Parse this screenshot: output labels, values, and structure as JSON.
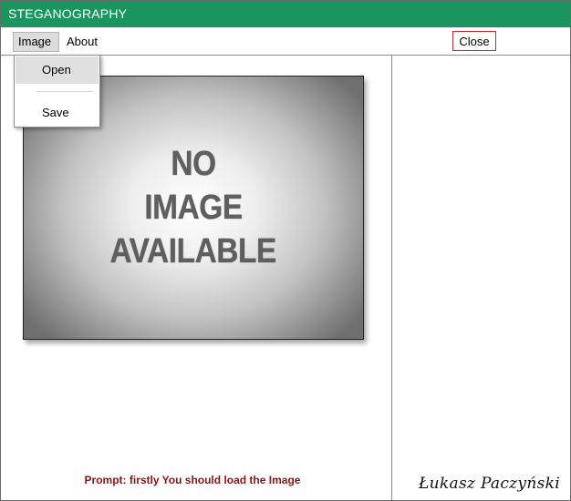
{
  "window": {
    "title": "STEGANOGRAPHY"
  },
  "menubar": {
    "items": [
      {
        "label": "Image"
      },
      {
        "label": "About"
      }
    ],
    "close_label": "Close"
  },
  "dropdown": {
    "items": [
      {
        "label": "Open"
      },
      {
        "label": "Save"
      }
    ]
  },
  "image_placeholder": {
    "lines": [
      "NO",
      "IMAGE",
      "AVAILABLE"
    ]
  },
  "status": {
    "prompt": "Prompt: firstly You should load the Image"
  },
  "signature": "Łukasz Paczyński",
  "colors": {
    "titlebar": "#1a9560",
    "close_border": "#c1272d",
    "prompt_text": "#8b1414"
  }
}
